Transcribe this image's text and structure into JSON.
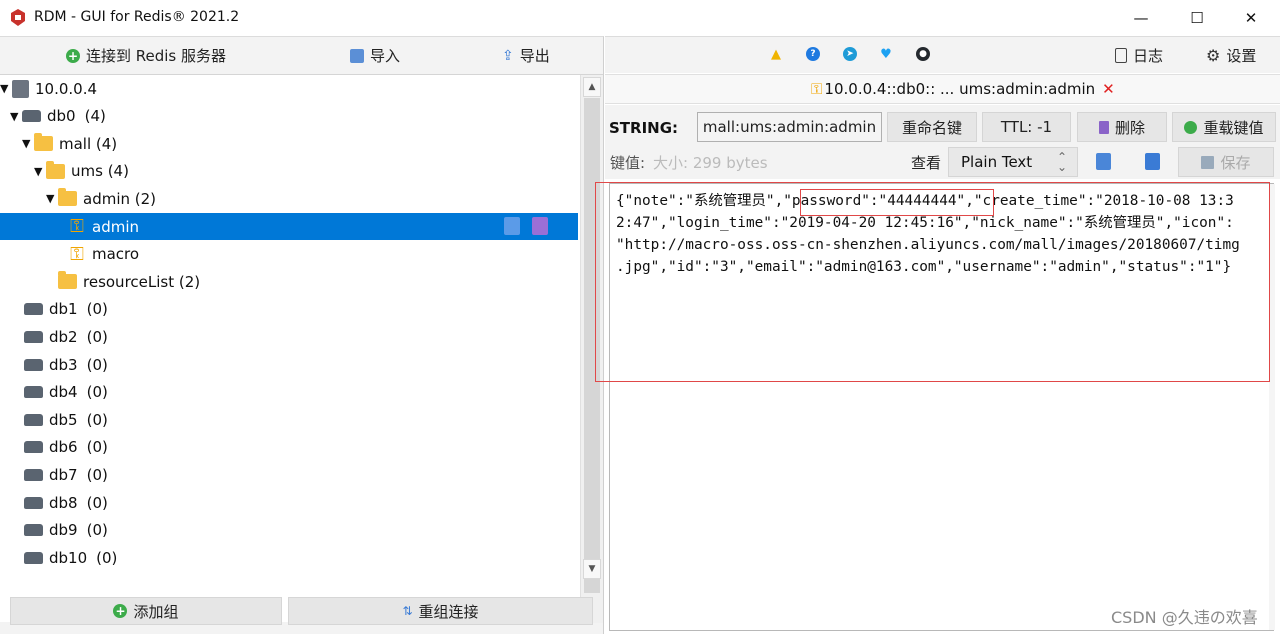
{
  "window": {
    "title": "RDM - GUI for Redis® 2021.2",
    "minimize": "—",
    "maximize": "☐",
    "close": "✕"
  },
  "left_toolbar": {
    "connect": "连接到 Redis 服务器",
    "import": "导入",
    "export": "导出"
  },
  "tree": [
    {
      "label": "10.0.0.4",
      "type": "server",
      "expanded": true
    },
    {
      "label": "db0",
      "count": "(4)",
      "type": "db",
      "expanded": true
    },
    {
      "label": "mall (4)",
      "type": "folder",
      "expanded": true
    },
    {
      "label": "ums (4)",
      "type": "folder",
      "expanded": true
    },
    {
      "label": "admin (2)",
      "type": "folder",
      "expanded": true
    },
    {
      "label": "admin",
      "type": "key",
      "selected": true
    },
    {
      "label": "macro",
      "type": "key"
    },
    {
      "label": "resourceList (2)",
      "type": "folder"
    },
    {
      "label": "db1",
      "count": "(0)",
      "type": "db"
    },
    {
      "label": "db2",
      "count": "(0)",
      "type": "db"
    },
    {
      "label": "db3",
      "count": "(0)",
      "type": "db"
    },
    {
      "label": "db4",
      "count": "(0)",
      "type": "db"
    },
    {
      "label": "db5",
      "count": "(0)",
      "type": "db"
    },
    {
      "label": "db6",
      "count": "(0)",
      "type": "db"
    },
    {
      "label": "db7",
      "count": "(0)",
      "type": "db"
    },
    {
      "label": "db8",
      "count": "(0)",
      "type": "db"
    },
    {
      "label": "db9",
      "count": "(0)",
      "type": "db"
    },
    {
      "label": "db10",
      "count": "(0)",
      "type": "db"
    }
  ],
  "left_bottom": {
    "add_group": "添加组",
    "regroup": "重组连接"
  },
  "right_toolbar": {
    "log": "日志",
    "settings": "设置"
  },
  "tab": {
    "title": "10.0.0.4::db0:: ... ums:admin:admin",
    "close": "✕"
  },
  "key_bar": {
    "type": "STRING:",
    "key_name": "mall:ums:admin:admin",
    "rename": "重命名键",
    "ttl": "TTL:  -1",
    "delete": "删除",
    "reload": "重载键值"
  },
  "value_bar": {
    "label": "键值:",
    "size": "大小: 299 bytes",
    "view_label": "查看",
    "view_mode": "Plain Text",
    "save": "保存"
  },
  "editor": {
    "lines": [
      "{\"note\":\"系统管理员\",\"password\":\"44444444\",\"create_time\":\"2018-10-08 13:3",
      "2:47\",\"login_time\":\"2019-04-20 12:45:16\",\"nick_name\":\"系统管理员\",\"icon\":",
      "\"http://macro-oss.oss-cn-shenzhen.aliyuncs.com/mall/images/20180607/timg",
      ".jpg\",\"id\":\"3\",\"email\":\"admin@163.com\",\"username\":\"admin\",\"status\":\"1\"}"
    ]
  },
  "watermark": "CSDN @久违の欢喜",
  "colors": {
    "selection": "#0078d7",
    "folder": "#f6c042",
    "key": "#f0a500",
    "highlight_box": "#e04848"
  }
}
